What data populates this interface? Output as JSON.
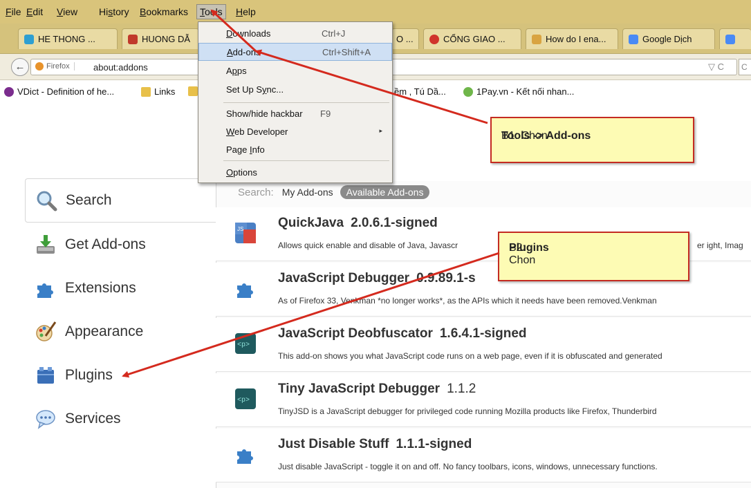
{
  "menubar": {
    "items": [
      {
        "pre": "",
        "key": "F",
        "post": "ile"
      },
      {
        "pre": "",
        "key": "E",
        "post": "dit"
      },
      {
        "pre": "",
        "key": "V",
        "post": "iew"
      },
      {
        "pre": "Hi",
        "key": "s",
        "post": "tory"
      },
      {
        "pre": "",
        "key": "B",
        "post": "ookmarks"
      },
      {
        "pre": "",
        "key": "T",
        "post": "ools"
      },
      {
        "pre": "",
        "key": "H",
        "post": "elp"
      }
    ]
  },
  "tabs": [
    {
      "label": "HE THONG ..."
    },
    {
      "label": "HUONG DẪ"
    },
    {
      "label": "O ..."
    },
    {
      "label": "CỔNG GIAO ..."
    },
    {
      "label": "How do I ena..."
    },
    {
      "label": "Google Dịch"
    }
  ],
  "navbar": {
    "badge": "Firefox",
    "url": "about:addons",
    "tools": "▽ C"
  },
  "bookmarks": [
    {
      "label": "VDict - Definition of he..."
    },
    {
      "label": "Links"
    },
    {
      "label": "ềm , Tú Dầ..."
    },
    {
      "label": "1Pay.vn - Kết nối nhan..."
    }
  ],
  "tools_menu": {
    "items": [
      {
        "pre": "",
        "key": "D",
        "post": "ownloads",
        "shortcut": "Ctrl+J"
      },
      {
        "pre": "",
        "key": "A",
        "post": "dd-ons",
        "shortcut": "Ctrl+Shift+A"
      },
      {
        "pre": "A",
        "key": "p",
        "post": "ps",
        "shortcut": ""
      },
      {
        "pre": "Set Up S",
        "key": "y",
        "post": "nc...",
        "shortcut": ""
      },
      {
        "pre": "Show/hide hackbar",
        "key": "",
        "post": "",
        "shortcut": "F9"
      },
      {
        "pre": "",
        "key": "W",
        "post": "eb Developer",
        "shortcut": ""
      },
      {
        "pre": "Page ",
        "key": "I",
        "post": "nfo",
        "shortcut": ""
      },
      {
        "pre": "",
        "key": "O",
        "post": "ptions",
        "shortcut": ""
      }
    ]
  },
  "sidebar": {
    "categories": [
      {
        "label": "Search"
      },
      {
        "label": "Get Add-ons"
      },
      {
        "label": "Extensions"
      },
      {
        "label": "Appearance"
      },
      {
        "label": "Plugins"
      },
      {
        "label": "Services"
      }
    ]
  },
  "search_scope": {
    "label": "Search:",
    "my": "My Add-ons",
    "available": "Available Add-ons"
  },
  "addons": [
    {
      "name": "QuickJava",
      "version": "2.0.6.1-signed",
      "description": "Allows quick enable and disable of Java, Javascr",
      "description_tail": "er ight, Imag"
    },
    {
      "name": "JavaScript Debugger",
      "version": "0.9.89.1-s",
      "description": "As of Firefox 33, Venkman *no longer works*, as the APIs which it needs have been removed.Venkman"
    },
    {
      "name": "JavaScript Deobfuscator",
      "version": "1.6.4.1-signed",
      "description": "This add-on shows you what JavaScript code runs on a web page, even if it is obfuscated and generated"
    },
    {
      "name": "Tiny JavaScript Debugger",
      "version": "1.1.2",
      "description": "TinyJSD is a JavaScript debugger for privileged code running Mozilla products like Firefox, Thunderbird"
    },
    {
      "name": "Just Disable Stuff",
      "version": "1.1.1-signed",
      "description": "Just disable JavaScript - toggle it on and off. No fancy toolbars, icons, windows, unnecessary functions."
    }
  ],
  "callouts": {
    "b1_prefix": "B1: Chon ",
    "b1_bold": "Tools -> Add-ons",
    "b2_prefix": "B2: Chon ",
    "b2_bold": "Plugins"
  },
  "colors": {
    "menubar": "#d9c47b",
    "callout_bg": "#fdfbb4",
    "arrow": "#d42a1e"
  }
}
